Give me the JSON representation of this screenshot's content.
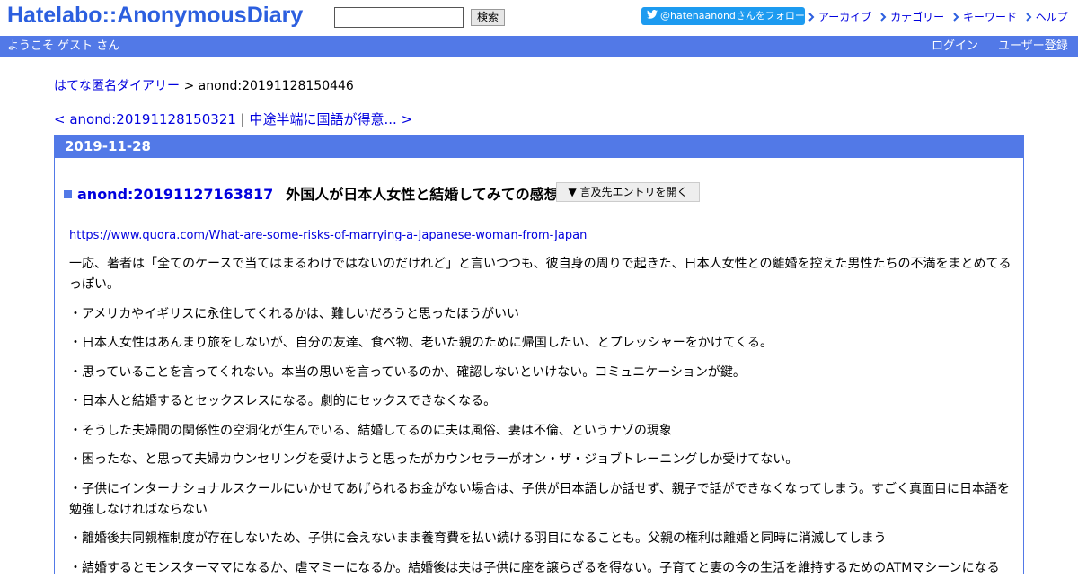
{
  "header": {
    "logo_left": "Hatelabo",
    "logo_sep": "::",
    "logo_right": "AnonymousDiary",
    "search_button": "検索",
    "follow_label": "@hatenaanondさんをフォロー",
    "links": [
      "アーカイブ",
      "カテゴリー",
      "キーワード",
      "ヘルプ"
    ]
  },
  "bar": {
    "welcome": "ようこそ ゲスト さん",
    "login": "ログイン",
    "register": "ユーザー登録"
  },
  "breadcrumb": {
    "home": "はてな匿名ダイアリー",
    "sep": " > ",
    "current": "anond:20191128150446"
  },
  "pager": {
    "prev": "< anond:20191128150321",
    "sep": " | ",
    "next": "中途半端に国語が得意... >"
  },
  "day": {
    "date": "2019-11-28"
  },
  "entry": {
    "id": "anond:20191127163817",
    "title": "外国人が日本人女性と結婚してみての感想",
    "mention_button": "▼ 言及先エントリを開く",
    "source_url": "https://www.quora.com/What-are-some-risks-of-marrying-a-Japanese-woman-from-Japan",
    "paragraphs": [
      "一応、著者は「全てのケースで当てはまるわけではないのだけれど」と言いつつも、彼自身の周りで起きた、日本人女性との離婚を控えた男性たちの不満をまとめてるっぽい。",
      "・アメリカやイギリスに永住してくれるかは、難しいだろうと思ったほうがいい",
      "・日本人女性はあんまり旅をしないが、自分の友達、食べ物、老いた親のために帰国したい、とプレッシャーをかけてくる。",
      "・思っていることを言ってくれない。本当の思いを言っているのか、確認しないといけない。コミュニケーションが鍵。",
      "・日本人と結婚するとセックスレスになる。劇的にセックスできなくなる。",
      "・そうした夫婦間の関係性の空洞化が生んでいる、結婚してるのに夫は風俗、妻は不倫、というナゾの現象",
      "・困ったな、と思って夫婦カウンセリングを受けようと思ったがカウンセラーがオン・ザ・ジョブトレーニングしか受けてない。",
      "・子供にインターナショナルスクールにいかせてあげられるお金がない場合は、子供が日本語しか話せず、親子で話ができなくなってしまう。すごく真面目に日本語を勉強しなければならない",
      "・離婚後共同親権制度が存在しないため、子供に会えないまま養育費を払い続ける羽目になることも。父親の権利は離婚と同時に消滅してしまう",
      "・結婚するとモンスターママになるか、虐マミーになるか。結婚後は夫は子供に座を譲らざるを得ない。子育てと妻の今の生活を維持するためのATMマシーンになる"
    ]
  },
  "colors": {
    "brand": "#2c5fdf",
    "bar": "#5279e7",
    "twitter": "#1d9bf0"
  }
}
